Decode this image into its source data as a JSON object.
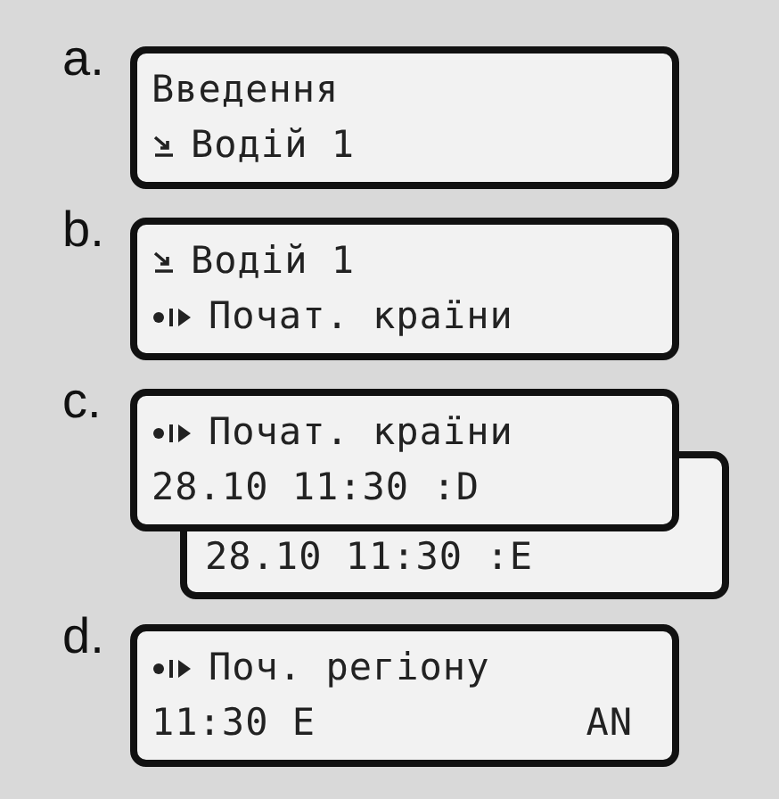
{
  "screens": [
    {
      "label": "a.",
      "lines": [
        {
          "kind": "plain",
          "text": "Введення"
        },
        {
          "kind": "card",
          "text": "Водій 1"
        }
      ]
    },
    {
      "label": "b.",
      "lines": [
        {
          "kind": "card",
          "text": "Водій 1"
        },
        {
          "kind": "place",
          "text": "Почат. країни"
        }
      ]
    },
    {
      "label": "c.",
      "lines": [
        {
          "kind": "place",
          "text": "Почат. країни"
        },
        {
          "kind": "plain",
          "text": "28.10 11:30 :D"
        }
      ],
      "behind": {
        "text": "28.10 11:30 :E"
      }
    },
    {
      "label": "d.",
      "lines": [
        {
          "kind": "place",
          "text": "Поч. регіону"
        },
        {
          "kind": "plain",
          "text": "11:30 E",
          "right_text": "AN"
        }
      ]
    }
  ]
}
